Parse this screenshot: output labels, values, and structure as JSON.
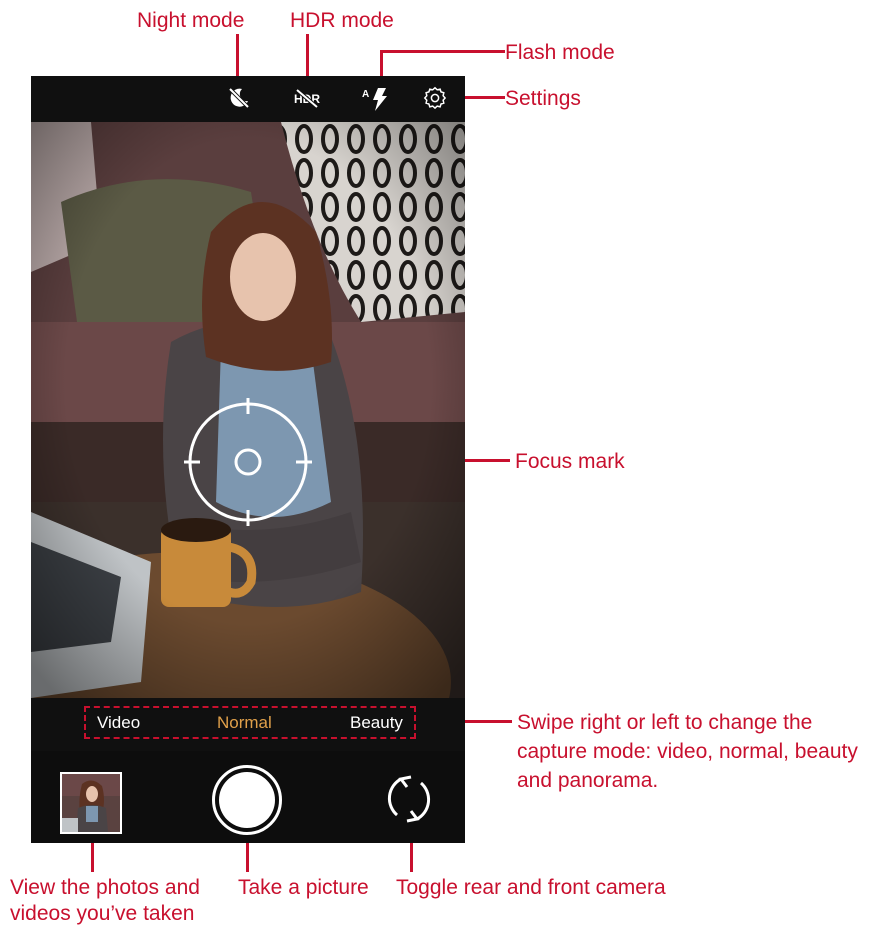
{
  "callouts": {
    "night_mode": "Night mode",
    "hdr_mode": "HDR mode",
    "flash_mode": "Flash mode",
    "settings": "Settings",
    "focus_mark": "Focus mark",
    "swipe_line1": "Swipe right or left to change the",
    "swipe_line2": "capture mode: video, normal, beauty",
    "swipe_line3": "and panorama.",
    "gallery_line1": "View the photos and",
    "gallery_line2": "videos you’ve taken",
    "shutter": "Take a picture",
    "switch_camera": "Toggle rear and front camera"
  },
  "modes": {
    "video": "Video",
    "normal": "Normal",
    "beauty": "Beauty",
    "selected": "normal"
  },
  "icons": {
    "night": "moon-off-icon",
    "hdr": "hdr-off-icon",
    "flash": "flash-auto-icon",
    "settings": "gear-icon",
    "focus": "focus-crosshair-icon",
    "switch": "camera-switch-icon"
  },
  "colors": {
    "callout": "#c8102e",
    "mode_selected": "#e0a04a",
    "mode_default": "#ffffff",
    "bar_background": "#101010"
  }
}
